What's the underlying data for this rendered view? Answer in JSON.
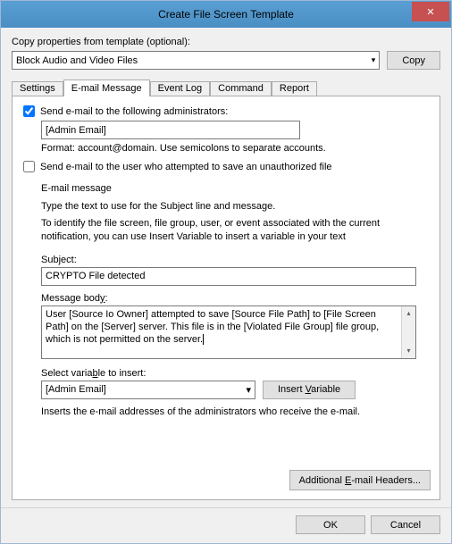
{
  "title": "Create File Screen Template",
  "copy": {
    "label": "Copy properties from template (optional):",
    "selected": "Block Audio and Video Files",
    "button": "Copy"
  },
  "tabs": {
    "settings": "Settings",
    "email": "E-mail Message",
    "eventlog": "Event Log",
    "command": "Command",
    "report": "Report"
  },
  "email": {
    "admin_check_label": "Send e-mail to the following administrators:",
    "admin_value": "[Admin Email]",
    "format_hint": "Format: account@domain. Use semicolons to separate accounts.",
    "user_check_label": "Send e-mail to the user who attempted to save an unauthorized file",
    "group_heading": "E-mail message",
    "desc1": "Type the text to use for the Subject line and message.",
    "desc2": "To identify the file screen, file group, user, or event associated with the current notification, you can use Insert Variable to insert a variable in your text",
    "subject_label": "Subject:",
    "subject_value": "CRYPTO File detected",
    "body_label": "Message body:",
    "body_value": "User [Source Io Owner] attempted to save [Source File Path] to [File Screen Path] on the [Server] server. This file is in the [Violated File Group] file group, which is not permitted on the server.",
    "select_var_label": "Select variable to insert:",
    "select_var_value": "[Admin Email]",
    "insert_var_btn": "Insert Variable",
    "insert_help": "Inserts the e-mail addresses of the administrators who receive the e-mail.",
    "additional_btn": "Additional E-mail Headers..."
  },
  "buttons": {
    "ok": "OK",
    "cancel": "Cancel"
  }
}
